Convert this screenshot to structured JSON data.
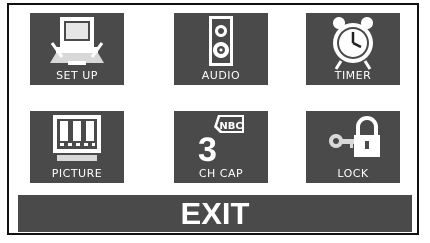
{
  "menu": {
    "items": [
      {
        "label": "SET UP",
        "icon": "setup-tv-icon"
      },
      {
        "label": "AUDIO",
        "icon": "speaker-icon"
      },
      {
        "label": "TIMER",
        "icon": "alarm-clock-icon"
      },
      {
        "label": "PICTURE",
        "icon": "picture-tv-icon"
      },
      {
        "label": "CH CAP",
        "icon": "channel-caption-icon"
      },
      {
        "label": "LOCK",
        "icon": "key-lock-icon"
      }
    ],
    "ch_cap_number": "3",
    "ch_cap_network": "NBC",
    "exit_label": "EXIT"
  },
  "colors": {
    "tile_background": "#4a4a4a",
    "icon_light": "#ffffff",
    "border": "#111111"
  }
}
